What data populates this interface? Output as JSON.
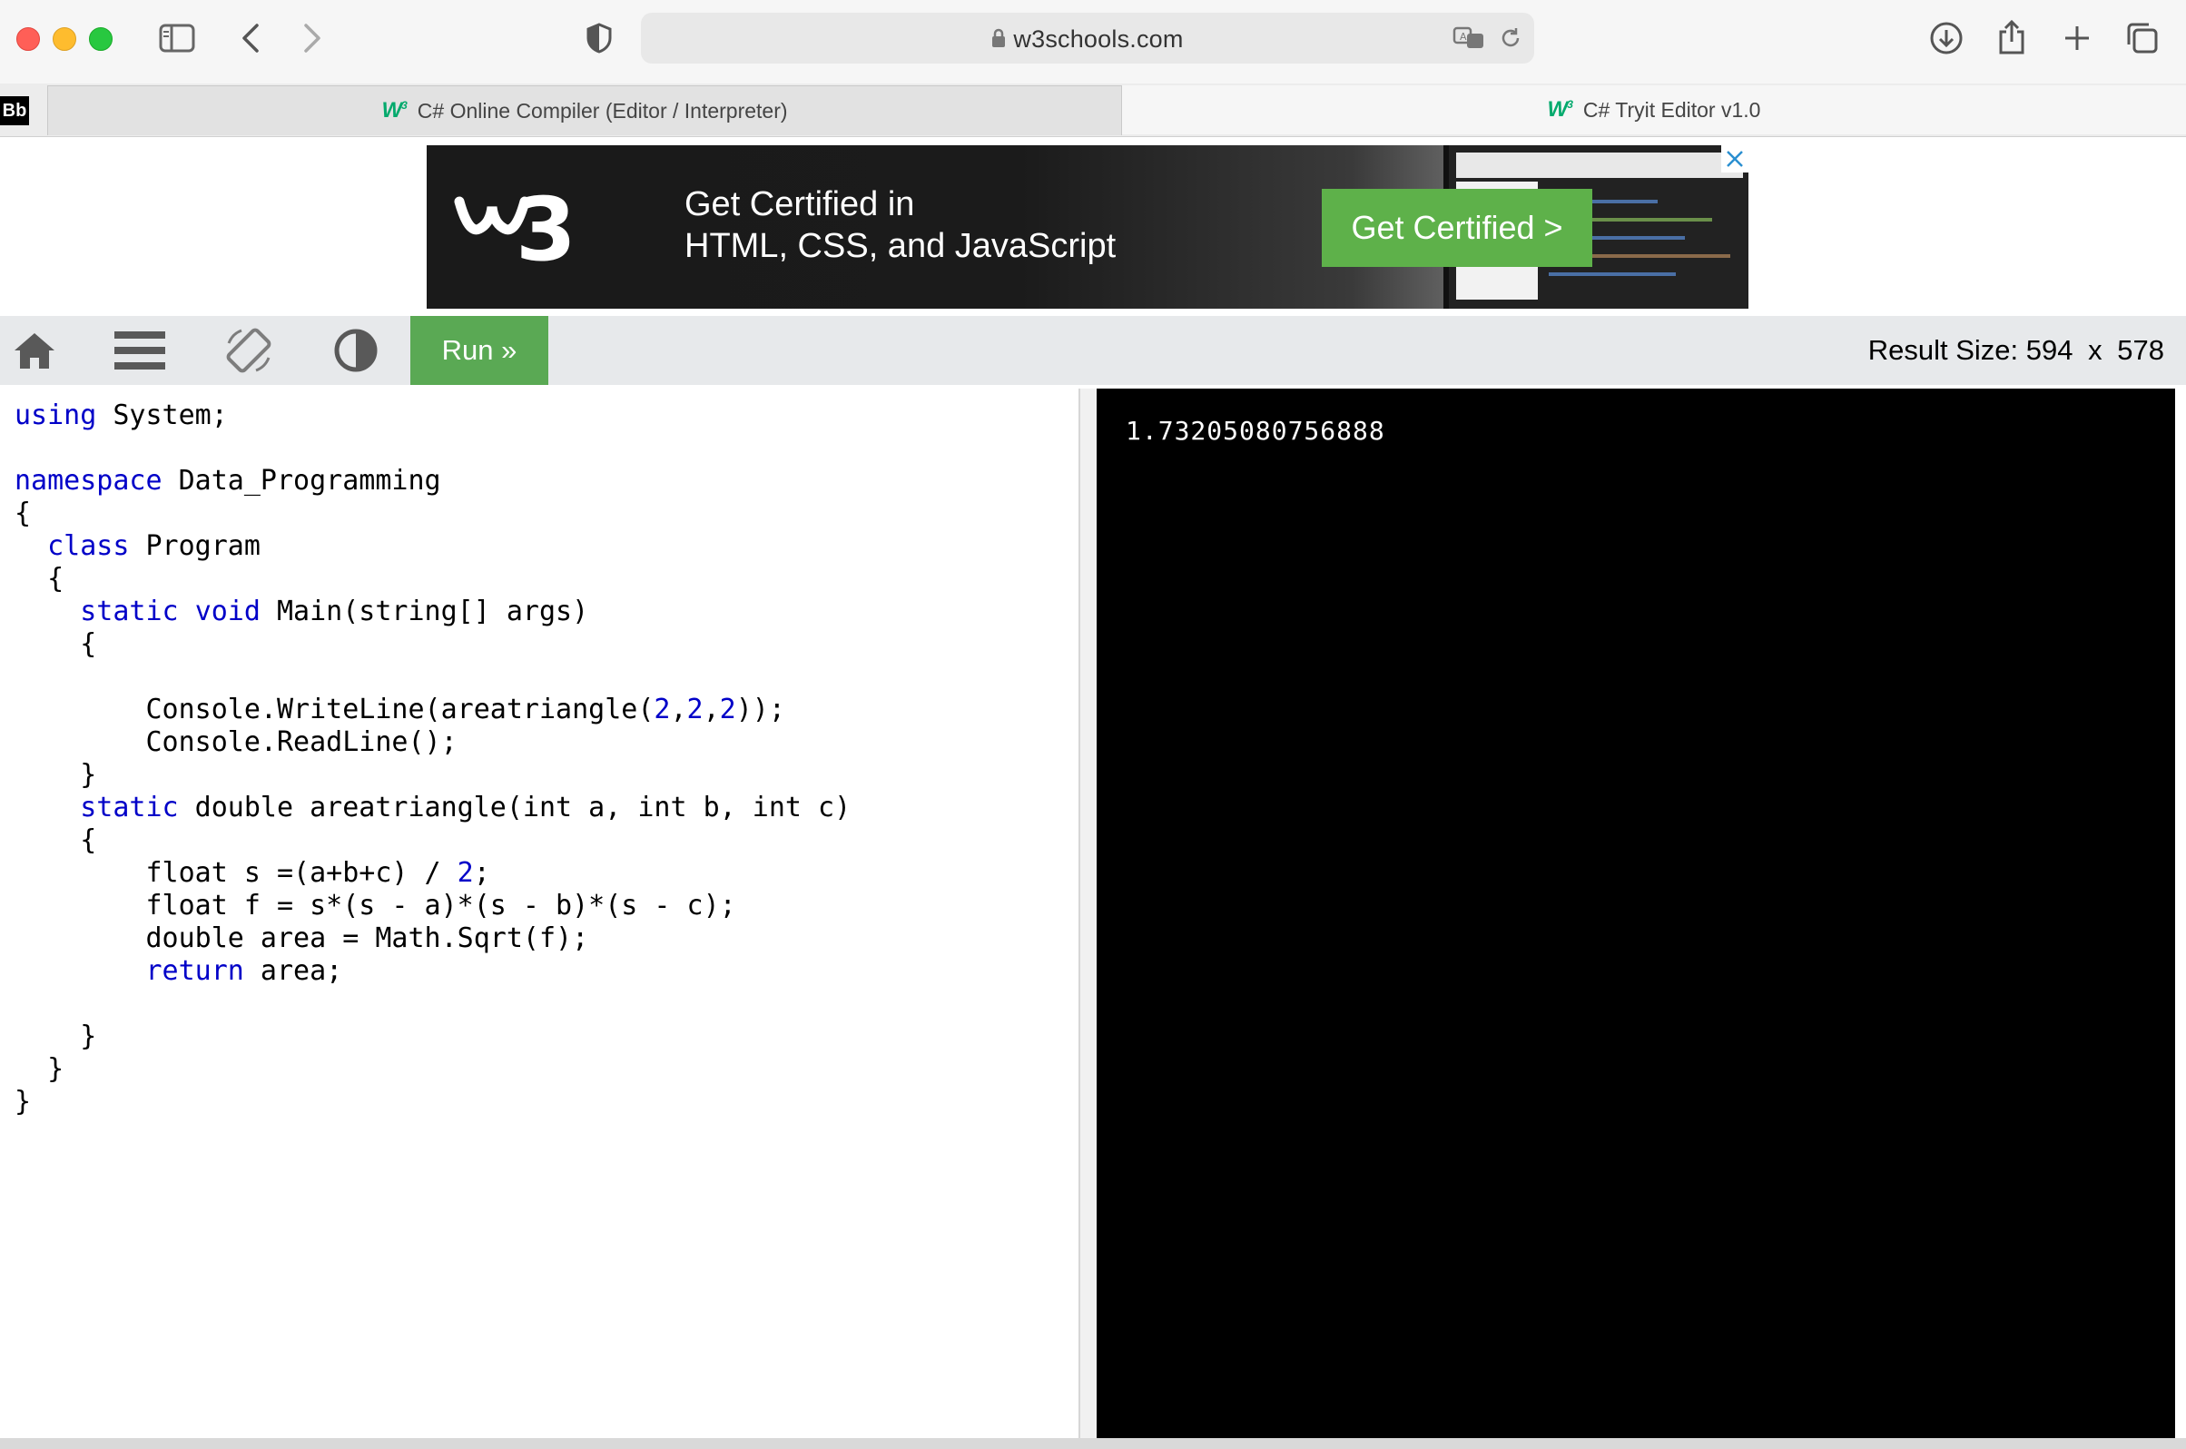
{
  "browser": {
    "url": "w3schools.com",
    "tabs": [
      {
        "label": "C# Online Compiler (Editor / Interpreter)",
        "active": false
      },
      {
        "label": "C# Tryit Editor v1.0",
        "active": true
      }
    ],
    "bookmark_badge": "Bb",
    "icons": [
      "sidebar-icon",
      "back-icon",
      "forward-icon",
      "shield-icon",
      "lock-icon",
      "translate-icon",
      "reload-icon",
      "download-icon",
      "share-icon",
      "new-tab-icon",
      "tab-overview-icon"
    ]
  },
  "ad": {
    "logo_text": "w3",
    "headline_line1": "Get Certified in",
    "headline_line2": "HTML, CSS, and JavaScript",
    "button_label": "Get Certified >",
    "accent_color": "#5eb14a"
  },
  "toolbar": {
    "run_label": "Run »",
    "result_size_label": "Result Size:",
    "result_width": "594",
    "result_x": "x",
    "result_height": "578",
    "icons": [
      "home-icon",
      "menu-icon",
      "rotate-icon",
      "contrast-icon"
    ]
  },
  "editor": {
    "lines": [
      [
        {
          "t": "using",
          "k": "kw"
        },
        {
          "t": " System;",
          "k": ""
        }
      ],
      [],
      [
        {
          "t": "namespace",
          "k": "kw"
        },
        {
          "t": " Data_Programming",
          "k": ""
        }
      ],
      [
        {
          "t": "{",
          "k": ""
        }
      ],
      [
        {
          "t": "  ",
          "k": ""
        },
        {
          "t": "class",
          "k": "kw"
        },
        {
          "t": " Program",
          "k": ""
        }
      ],
      [
        {
          "t": "  {",
          "k": ""
        }
      ],
      [
        {
          "t": "    ",
          "k": ""
        },
        {
          "t": "static",
          "k": "kw"
        },
        {
          "t": " ",
          "k": ""
        },
        {
          "t": "void",
          "k": "kw"
        },
        {
          "t": " Main(string[] args)",
          "k": ""
        }
      ],
      [
        {
          "t": "    {",
          "k": ""
        }
      ],
      [],
      [
        {
          "t": "        Console.WriteLine(areatriangle(",
          "k": ""
        },
        {
          "t": "2",
          "k": "num"
        },
        {
          "t": ",",
          "k": ""
        },
        {
          "t": "2",
          "k": "num"
        },
        {
          "t": ",",
          "k": ""
        },
        {
          "t": "2",
          "k": "num"
        },
        {
          "t": "));",
          "k": ""
        }
      ],
      [
        {
          "t": "        Console.ReadLine();",
          "k": ""
        }
      ],
      [
        {
          "t": "    }",
          "k": ""
        }
      ],
      [
        {
          "t": "    ",
          "k": ""
        },
        {
          "t": "static",
          "k": "kw"
        },
        {
          "t": " double areatriangle(int a, int b, int c)",
          "k": ""
        }
      ],
      [
        {
          "t": "    {",
          "k": ""
        }
      ],
      [
        {
          "t": "        float s =(a+b+c) / ",
          "k": ""
        },
        {
          "t": "2",
          "k": "num"
        },
        {
          "t": ";",
          "k": ""
        }
      ],
      [
        {
          "t": "        float f = s*(s - a)*(s - b)*(s - c);",
          "k": ""
        }
      ],
      [
        {
          "t": "        double area = Math.Sqrt(f);",
          "k": ""
        }
      ],
      [
        {
          "t": "        ",
          "k": ""
        },
        {
          "t": "return",
          "k": "kw"
        },
        {
          "t": " area;",
          "k": ""
        }
      ],
      [],
      [
        {
          "t": "    }",
          "k": ""
        }
      ],
      [
        {
          "t": "  }",
          "k": ""
        }
      ],
      [
        {
          "t": "}",
          "k": ""
        }
      ]
    ]
  },
  "result": {
    "output": "1.73205080756888"
  }
}
